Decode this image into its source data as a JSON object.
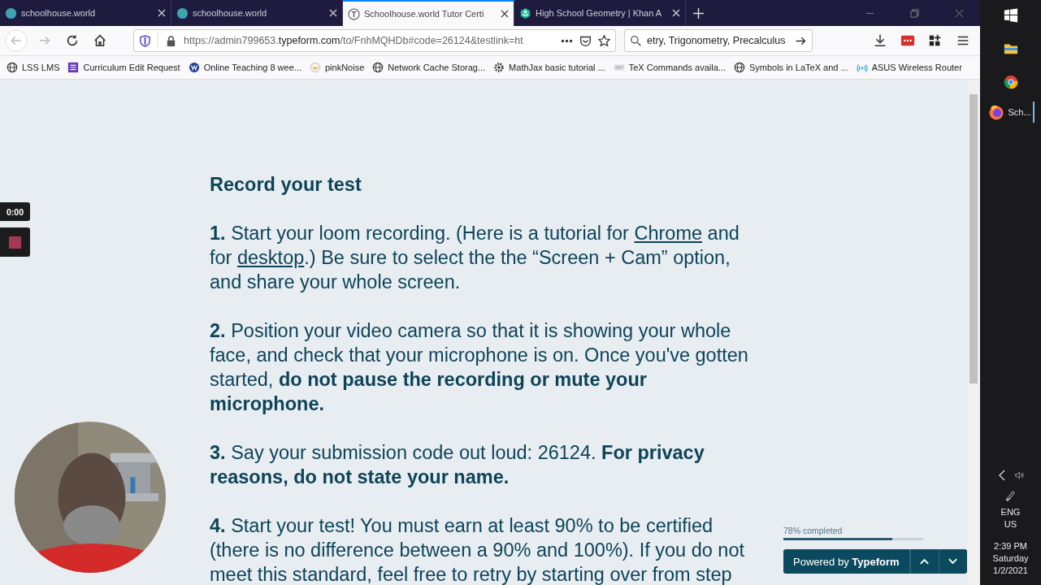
{
  "tabs": [
    {
      "title": "schoolhouse.world",
      "kind": "globe",
      "selected": false
    },
    {
      "title": "schoolhouse.world",
      "kind": "globe",
      "selected": false
    },
    {
      "title": "Schoolhouse.world Tutor Certi",
      "kind": "t",
      "selected": true
    },
    {
      "title": "High School Geometry | Khan A",
      "kind": "khan",
      "selected": false
    }
  ],
  "address": {
    "prefix": "https://admin799653.",
    "domain": "typeform.com",
    "rest": "/to/FnhMQHDb#code=26124&testlink=ht"
  },
  "search": {
    "value": "etry, Trigonometry, Precalculus"
  },
  "bookmarks": [
    {
      "label": "LSS LMS",
      "kind": "globe"
    },
    {
      "label": "Curriculum Edit Request",
      "kind": "form"
    },
    {
      "label": "Online Teaching 8 wee...",
      "kind": "w"
    },
    {
      "label": "pinkNoise",
      "kind": "noise"
    },
    {
      "label": "Network Cache Storag...",
      "kind": "globe"
    },
    {
      "label": "MathJax basic tutorial ...",
      "kind": "gear"
    },
    {
      "label": "TeX Commands availa...",
      "kind": "tex"
    },
    {
      "label": "Symbols in LaTeX and ...",
      "kind": "globe"
    },
    {
      "label": "ASUS Wireless Router",
      "kind": "wifi"
    }
  ],
  "content": {
    "heading": "Record your test",
    "paragraphs": [
      [
        {
          "kind": "bold",
          "text": "1."
        },
        {
          "kind": "text",
          "text": " Start your loom recording. (Here is a tutorial for "
        },
        {
          "kind": "link",
          "text": "Chrome"
        },
        {
          "kind": "text",
          "text": " and for "
        },
        {
          "kind": "link",
          "text": "desktop"
        },
        {
          "kind": "text",
          "text": ".) Be sure to select the the “Screen + Cam” option, and share your whole screen."
        }
      ],
      [
        {
          "kind": "bold",
          "text": "2."
        },
        {
          "kind": "text",
          "text": " Position your video camera so that it is showing your whole face, and check that your microphone is on. Once you've gotten started, "
        },
        {
          "kind": "bold",
          "text": "do not pause the recording or mute your microphone."
        }
      ],
      [
        {
          "kind": "bold",
          "text": "3."
        },
        {
          "kind": "text",
          "text": " Say your submission code out loud: 26124. "
        },
        {
          "kind": "bold",
          "text": "For privacy reasons, do not state your name."
        }
      ],
      [
        {
          "kind": "bold",
          "text": "4."
        },
        {
          "kind": "text",
          "text": " Start your test! You must earn at least 90% to be certified (there is no difference between a 90% and 100%). If you do not meet this standard, feel free to retry by starting over from step"
        }
      ]
    ]
  },
  "recorder": {
    "timer": "0:00"
  },
  "progress": {
    "label": "78% completed",
    "level": 0.78
  },
  "powered": "Powered by **Typeform**",
  "taskbar": {
    "app_label": "Sch...",
    "language": "ENG",
    "region": "US",
    "time": "2:39 PM",
    "day": "Saturday",
    "date": "1/2/2021"
  }
}
